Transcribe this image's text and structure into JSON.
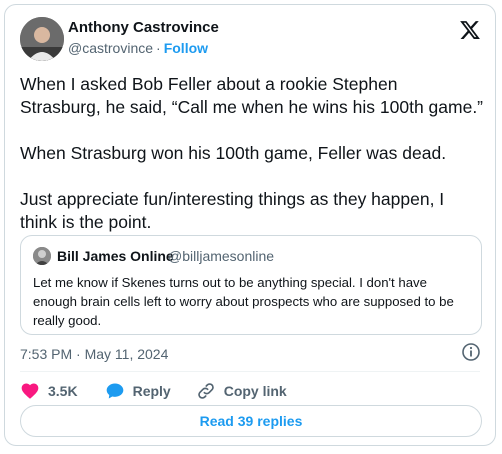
{
  "author": {
    "name": "Anthony Castrovince",
    "handle": "@castrovince",
    "separator": "·",
    "follow_label": "Follow"
  },
  "tweet": {
    "paragraphs": [
      "When I asked Bob Feller about a rookie Stephen\nStrasburg, he said, “Call me when he wins his 100th game.”",
      "When Strasburg won his 100th game, Feller was dead.",
      "Just appreciate fun/interesting things as they happen, I\nthink is the point."
    ]
  },
  "quote": {
    "name": "Bill James Online",
    "handle": "@billjamesonline",
    "text": "Let me know if Skenes turns out to be anything special. I don't have enough brain cells left to worry about prospects who are supposed to be really good."
  },
  "timestamp": "7:53 PM · May 11, 2024",
  "actions": {
    "likes": "3.5K",
    "reply_label": "Reply",
    "copy_label": "Copy link"
  },
  "read_replies_label": "Read 39 replies",
  "colors": {
    "accent": "#1d9bf0",
    "heart": "#f91880",
    "muted": "#536471",
    "border": "#cfd9de"
  },
  "icons": {
    "platform": "x-logo-icon",
    "info": "info-icon",
    "like": "heart-icon",
    "reply": "speech-bubble-icon",
    "copy": "link-icon"
  }
}
